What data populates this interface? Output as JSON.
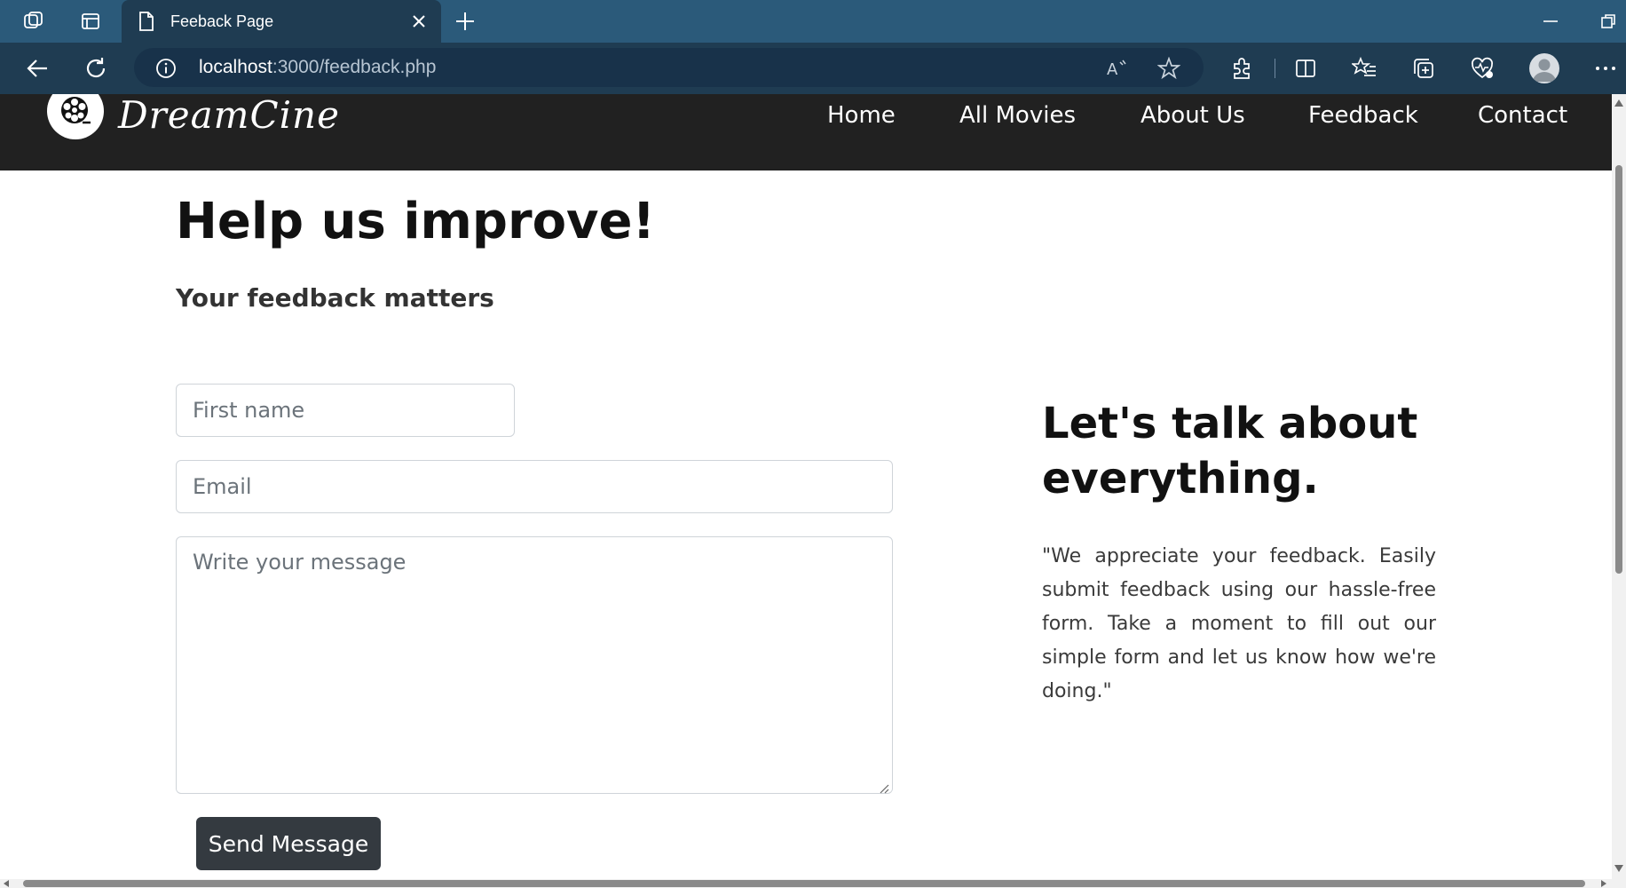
{
  "browser": {
    "tab_title": "Feeback Page",
    "url_host": "localhost",
    "url_path": ":3000/feedback.php"
  },
  "site": {
    "brand": "DreamCine",
    "nav": [
      "Home",
      "All Movies",
      "About Us",
      "Feedback",
      "Contact"
    ]
  },
  "main": {
    "heading": "Help us improve!",
    "subheading": "Your feedback matters",
    "form": {
      "first_name_placeholder": "First name",
      "email_placeholder": "Email",
      "message_placeholder": "Write your message",
      "submit_label": "Send Message"
    },
    "aside": {
      "heading": "Let's talk about everything.",
      "quote": "\"We appreciate your feedback. Easily submit feedback using our hassle-free form. Take a moment to fill out our simple form and let us know how we're doing.\""
    }
  },
  "colors": {
    "titlebar": "#2b5a7a",
    "addressbar": "#1f3c52",
    "site_nav": "#212121",
    "button": "#343a40"
  },
  "icons": [
    "workspaces-icon",
    "tab-actions-icon",
    "page-icon",
    "close-icon",
    "plus-icon",
    "minimize-icon",
    "restore-icon",
    "back-arrow-icon",
    "refresh-icon",
    "info-icon",
    "read-aloud-icon",
    "favorite-star-icon",
    "extensions-icon",
    "split-screen-icon",
    "favorites-icon",
    "collections-icon",
    "browser-essentials-icon",
    "profile-icon",
    "more-icon",
    "film-reel-icon"
  ]
}
